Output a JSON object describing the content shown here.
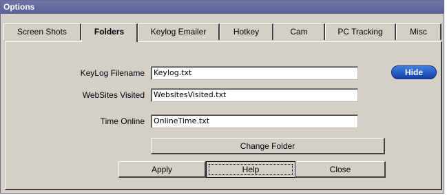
{
  "window": {
    "title": "Options"
  },
  "tabs": [
    {
      "label": "Screen Shots"
    },
    {
      "label": "Folders"
    },
    {
      "label": "Keylog Emailer"
    },
    {
      "label": "Hotkey"
    },
    {
      "label": "Cam"
    },
    {
      "label": "PC Tracking"
    },
    {
      "label": "Misc"
    }
  ],
  "active_tab": "Folders",
  "form": {
    "keylog_label": "KeyLog Filename",
    "keylog_value": "Keylog.txt",
    "websites_label": "WebSites Visited",
    "websites_value": "WebsitesVisited.txt",
    "time_label": "Time Online",
    "time_value": "OnlineTime.txt",
    "hide_label": "Hide",
    "change_folder_label": "Change Folder"
  },
  "buttons": {
    "apply": "Apply",
    "help": "Help",
    "close": "Close"
  },
  "colors": {
    "titlebar": "#5f64a0",
    "hide_button": "#1f55c8",
    "face": "#d4d0c8"
  }
}
